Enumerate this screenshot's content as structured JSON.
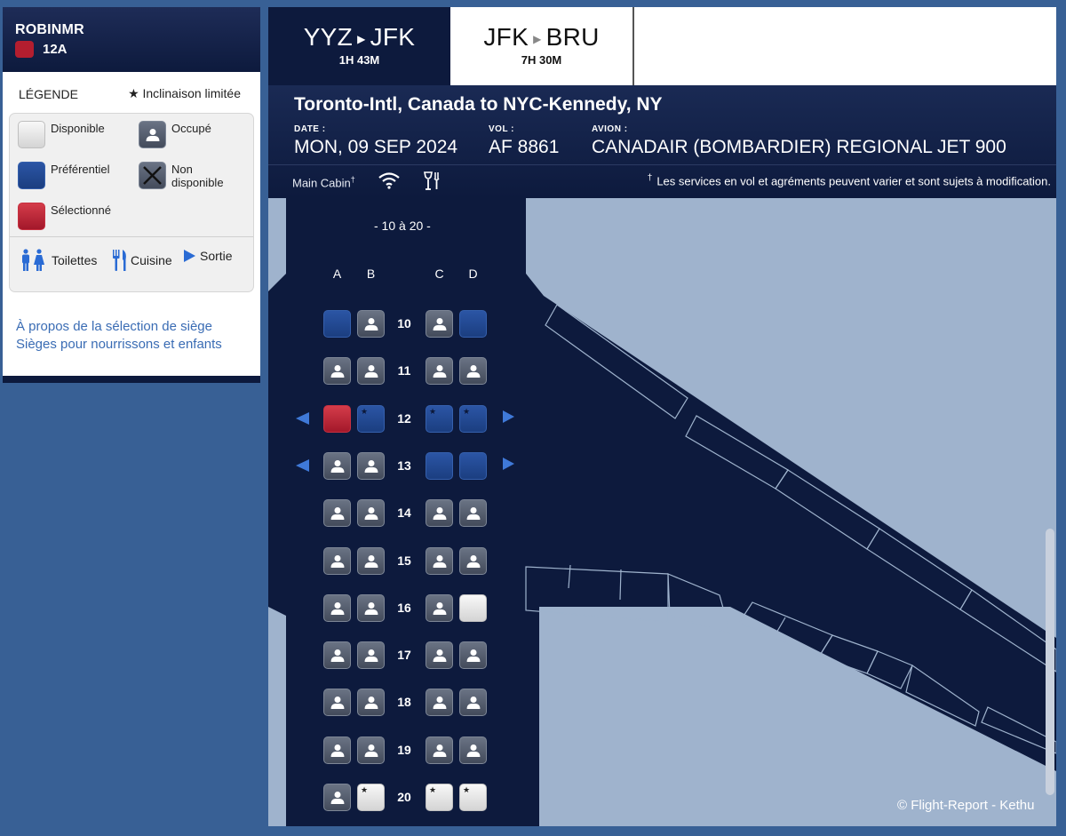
{
  "passenger": {
    "name": "ROBINMR",
    "seat": "12A"
  },
  "legend": {
    "title": "LÉGENDE",
    "limited_recline": "★ Inclinaison limitée",
    "available": "Disponible",
    "occupied": "Occupé",
    "preferred": "Préférentiel",
    "unavailable": "Non disponible",
    "selected": "Sélectionné",
    "lavatory": "Toilettes",
    "galley": "Cuisine",
    "exit": "Sortie"
  },
  "links": {
    "about": "À propos de la sélection de siège",
    "infants": "Sièges pour nourrissons et enfants"
  },
  "tabs": [
    {
      "from": "YYZ",
      "to": "JFK",
      "duration": "1H 43M",
      "active": true
    },
    {
      "from": "JFK",
      "to": "BRU",
      "duration": "7H 30M",
      "active": false
    }
  ],
  "flight": {
    "route_title": "Toronto-Intl, Canada to NYC-Kennedy, NY",
    "date_label": "DATE :",
    "date": "MON, 09 SEP 2024",
    "flight_label": "VOL :",
    "flight": "AF 8861",
    "aircraft_label": "AVION :",
    "aircraft": "CANADAIR (BOMBARDIER) REGIONAL JET 900",
    "cabin": "Main Cabin",
    "cabin_mark": "†",
    "notice_mark": "†",
    "notice": "Les services en vol et agréments peuvent varier et sont sujets à modification."
  },
  "seatmap": {
    "range_label": "- 10 à 20 -",
    "columns": [
      "A",
      "B",
      "C",
      "D"
    ],
    "rows": [
      {
        "number": "10",
        "seats": [
          "pref",
          "occ",
          "occ",
          "pref"
        ],
        "exit": false
      },
      {
        "number": "11",
        "seats": [
          "occ",
          "occ",
          "occ",
          "occ"
        ],
        "exit": false
      },
      {
        "number": "12",
        "seats": [
          "sel",
          "pref-star",
          "pref-star",
          "pref-star"
        ],
        "exit": true
      },
      {
        "number": "13",
        "seats": [
          "occ",
          "occ",
          "pref",
          "pref"
        ],
        "exit": true
      },
      {
        "number": "14",
        "seats": [
          "occ",
          "occ",
          "occ",
          "occ"
        ],
        "exit": false
      },
      {
        "number": "15",
        "seats": [
          "occ",
          "occ",
          "occ",
          "occ"
        ],
        "exit": false
      },
      {
        "number": "16",
        "seats": [
          "occ",
          "occ",
          "occ",
          "avail"
        ],
        "exit": false
      },
      {
        "number": "17",
        "seats": [
          "occ",
          "occ",
          "occ",
          "occ"
        ],
        "exit": false
      },
      {
        "number": "18",
        "seats": [
          "occ",
          "occ",
          "occ",
          "occ"
        ],
        "exit": false
      },
      {
        "number": "19",
        "seats": [
          "occ",
          "occ",
          "occ",
          "occ"
        ],
        "exit": false
      },
      {
        "number": "20",
        "seats": [
          "occ",
          "avail-star",
          "avail-star",
          "avail-star"
        ],
        "exit": false
      }
    ]
  },
  "credit": "© Flight-Report - Kethu",
  "colors": {
    "navy": "#0d1a3d",
    "preferred": "#1f4690",
    "selected": "#b41e2f",
    "exit_arrow": "#3f79d8",
    "link": "#3a6cb4",
    "background": "#386095"
  }
}
